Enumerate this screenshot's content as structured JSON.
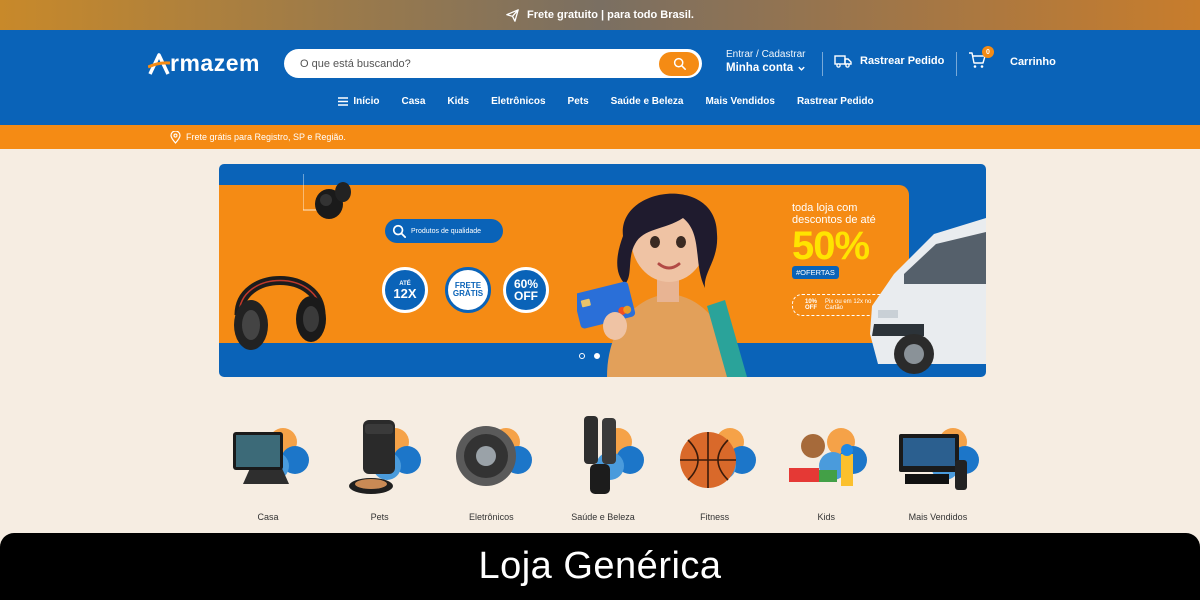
{
  "promo_strip": {
    "text": "Frete gratuito | para todo Brasil."
  },
  "header": {
    "logo_text": "rmazem",
    "search": {
      "placeholder": "O que está buscando?"
    },
    "account": {
      "top": "Entrar / Cadastrar",
      "main": "Minha conta"
    },
    "track_label": "Rastrear Pedido",
    "cart": {
      "count": "0",
      "label": "Carrinho"
    }
  },
  "nav": {
    "items": [
      {
        "label": "Início",
        "icon": "menu-icon"
      },
      {
        "label": "Casa"
      },
      {
        "label": "Kids"
      },
      {
        "label": "Eletrônicos"
      },
      {
        "label": "Pets"
      },
      {
        "label": "Saúde e Beleza"
      },
      {
        "label": "Mais Vendidos"
      },
      {
        "label": "Rastrear Pedido"
      }
    ]
  },
  "shipping_bar": {
    "text": "Frete grátis para Registro, SP e Região."
  },
  "banner": {
    "pill": "Produtos de qualidade",
    "badge_installments": {
      "small": "ATÉ",
      "big": "12X"
    },
    "badge_shipping": {
      "line1": "FRETE",
      "line2": "GRÁTIS"
    },
    "badge_discount": {
      "line1": "60%",
      "line2": "OFF"
    },
    "promo_line1": "toda loja com",
    "promo_line2": "descontos de até",
    "promo_big": "50%",
    "tag": "#OFERTAS",
    "pix_left": "10% OFF",
    "pix_right": "Pix ou em 12x no Cartão",
    "slides_total": 2,
    "slide_active": 2
  },
  "categories": [
    {
      "label": "Casa",
      "icon": "smart-display-icon"
    },
    {
      "label": "Pets",
      "icon": "pet-feeder-icon"
    },
    {
      "label": "Eletrônicos",
      "icon": "robot-vacuum-icon"
    },
    {
      "label": "Saúde e Beleza",
      "icon": "hair-straightener-icon"
    },
    {
      "label": "Fitness",
      "icon": "basketball-icon"
    },
    {
      "label": "Kids",
      "icon": "toys-icon"
    },
    {
      "label": "Mais Vendidos",
      "icon": "car-stereo-icon"
    }
  ],
  "caption": "Loja Genérica",
  "colors": {
    "primary": "#0a63b8",
    "accent": "#f58b14",
    "background": "#f6ede2",
    "highlight": "#ffe400"
  }
}
